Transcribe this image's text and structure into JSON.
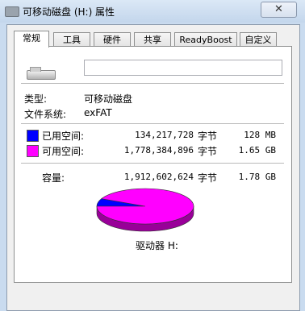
{
  "window": {
    "title": "可移动磁盘 (H:) 属性",
    "close_symbol": "✕"
  },
  "tabs": [
    "常规",
    "工具",
    "硬件",
    "共享",
    "ReadyBoost",
    "自定义"
  ],
  "general": {
    "volume_name": "",
    "type_label": "类型:",
    "type_value": "可移动磁盘",
    "fs_label": "文件系统:",
    "fs_value": "exFAT",
    "used": {
      "label": "已用空间:",
      "bytes": "134,217,728",
      "unit": "字节",
      "size": "128 MB",
      "color": "#0000ff"
    },
    "free": {
      "label": "可用空间:",
      "bytes": "1,778,384,896",
      "unit": "字节",
      "size": "1.65 GB",
      "color": "#ff00ff"
    },
    "capacity": {
      "label": "容量:",
      "bytes": "1,912,602,624",
      "unit": "字节",
      "size": "1.78 GB"
    },
    "drive_label": "驱动器 H:"
  },
  "chart_data": {
    "type": "pie",
    "title": "",
    "slices": [
      {
        "label": "已用空间",
        "value": 134217728,
        "color": "#0000ff"
      },
      {
        "label": "可用空间",
        "value": 1778384896,
        "color": "#ff00ff"
      }
    ]
  }
}
